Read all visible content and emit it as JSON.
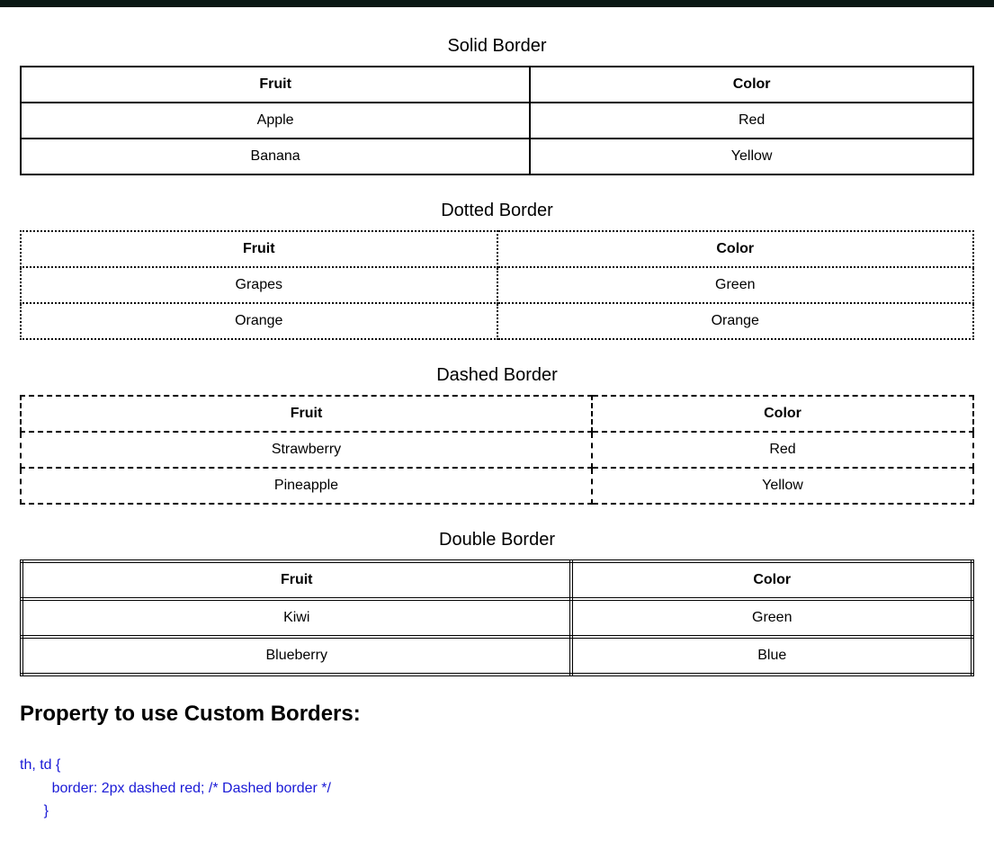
{
  "tables": [
    {
      "caption": "Solid Border",
      "style": "solid",
      "headers": [
        "Fruit",
        "Color"
      ],
      "rows": [
        [
          "Apple",
          "Red"
        ],
        [
          "Banana",
          "Yellow"
        ]
      ]
    },
    {
      "caption": "Dotted Border",
      "style": "dotted",
      "headers": [
        "Fruit",
        "Color"
      ],
      "rows": [
        [
          "Grapes",
          "Green"
        ],
        [
          "Orange",
          "Orange"
        ]
      ]
    },
    {
      "caption": "Dashed Border",
      "style": "dashed",
      "headers": [
        "Fruit",
        "Color"
      ],
      "rows": [
        [
          "Strawberry",
          "Red"
        ],
        [
          "Pineapple",
          "Yellow"
        ]
      ]
    },
    {
      "caption": "Double Border",
      "style": "double",
      "headers": [
        "Fruit",
        "Color"
      ],
      "rows": [
        [
          "Kiwi",
          "Green"
        ],
        [
          "Blueberry",
          "Blue"
        ]
      ]
    }
  ],
  "section_heading": "Property to use Custom Borders:",
  "code": {
    "line1": "th, td {",
    "line2": "        border: 2px dashed red; /* Dashed border */",
    "line3": "      }"
  }
}
